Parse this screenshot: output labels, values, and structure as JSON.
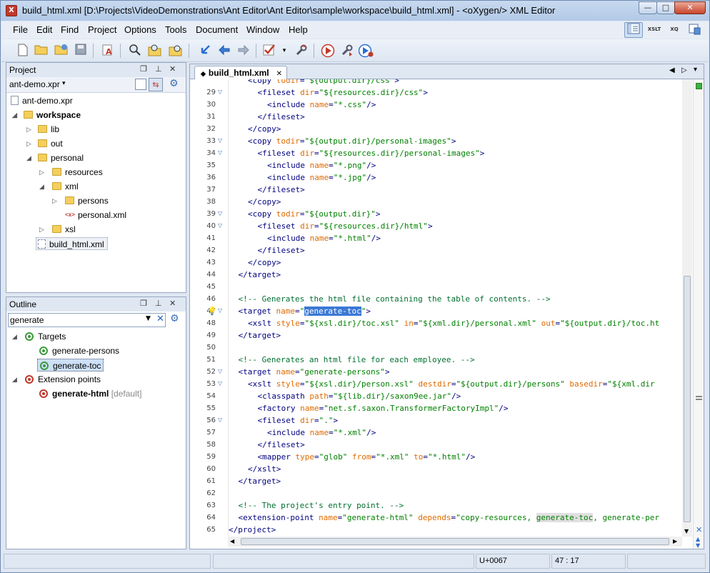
{
  "window": {
    "title": "build_html.xml [D:\\Projects\\VideoDemonstrations\\Ant Editor\\Ant Editor\\sample\\workspace\\build_html.xml] - <oXygen/> XML Editor",
    "min_glyph": "—",
    "max_glyph": "□",
    "close_glyph": "✕"
  },
  "menu": [
    "File",
    "Edit",
    "Find",
    "Project",
    "Options",
    "Tools",
    "Document",
    "Window",
    "Help"
  ],
  "perspectives": [
    "XSLT",
    "XQ"
  ],
  "project": {
    "title": "Project",
    "selector": "ant-demo.xpr",
    "items": [
      "ant-demo.xpr",
      "workspace",
      "lib",
      "out",
      "personal",
      "resources",
      "xml",
      "persons",
      "personal.xml",
      "xsl",
      "build_html.xml"
    ]
  },
  "outline": {
    "title": "Outline",
    "filter": "generate",
    "targets_label": "Targets",
    "targets": [
      "generate-persons",
      "generate-toc"
    ],
    "ext_label": "Extension points",
    "ext_item": "generate-html",
    "ext_default": "[default]"
  },
  "editor": {
    "tab": "build_html.xml",
    "first_line": "<copy todir=\"${output.dir}/css\">"
  },
  "status": {
    "unicode": "U+0067",
    "position": "47 : 17"
  },
  "colors": {
    "tag": "#000080",
    "attr_name": "#e06a00",
    "attr_value": "#008000",
    "comment": "#007030",
    "selection": "#3b78d6"
  },
  "icons": [
    "new-file-icon",
    "open-folder-icon",
    "save-icon",
    "search-icon",
    "run-icon",
    "validate-icon",
    "debug-icon"
  ]
}
